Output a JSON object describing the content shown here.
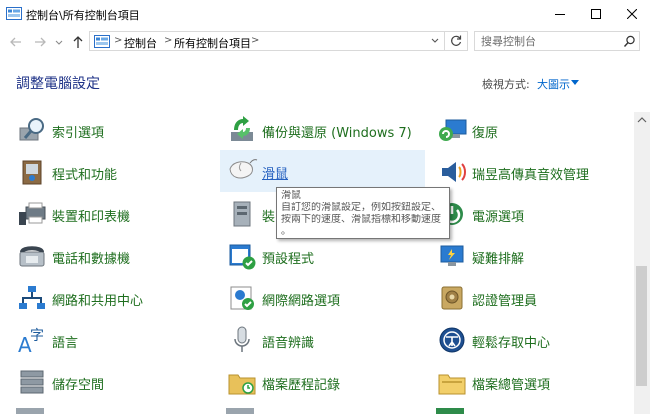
{
  "window": {
    "title": "控制台\\所有控制台項目",
    "icon": "control-panel-icon",
    "minimize_icon": "minimize-icon",
    "maximize_icon": "maximize-icon",
    "close_icon": "close-icon"
  },
  "address_bar": {
    "back_icon": "back-arrow-icon",
    "forward_icon": "forward-arrow-icon",
    "history_icon": "chevron-down-icon",
    "up_icon": "up-arrow-icon",
    "breadcrumbs": [
      "控制台",
      "所有控制台項目"
    ],
    "separator": ">",
    "dropdown_icon": "chevron-down-icon",
    "refresh_icon": "refresh-icon"
  },
  "search": {
    "placeholder": "搜尋控制台",
    "value": "",
    "icon": "search-icon"
  },
  "header": {
    "title": "調整電腦設定",
    "view_label": "檢視方式:",
    "view_value": "大圖示"
  },
  "items": [
    {
      "label": "索引選項",
      "icon": "indexing-options-icon"
    },
    {
      "label": "備份與還原 (Windows 7)",
      "icon": "backup-restore-icon"
    },
    {
      "label": "復原",
      "icon": "recovery-icon"
    },
    {
      "label": "程式和功能",
      "icon": "programs-features-icon"
    },
    {
      "label": "滑鼠",
      "icon": "mouse-icon"
    },
    {
      "label": "瑞昱高傳真音效管理",
      "icon": "realtek-audio-icon"
    },
    {
      "label": "裝置和印表機",
      "icon": "devices-printers-icon"
    },
    {
      "label": "裝",
      "icon": "device-manager-icon"
    },
    {
      "label": "電源選項",
      "icon": "power-options-icon"
    },
    {
      "label": "電話和數據機",
      "icon": "phone-modem-icon"
    },
    {
      "label": "預設程式",
      "icon": "default-programs-icon"
    },
    {
      "label": "疑難排解",
      "icon": "troubleshooting-icon"
    },
    {
      "label": "網路和共用中心",
      "icon": "network-sharing-icon"
    },
    {
      "label": "網際網路選項",
      "icon": "internet-options-icon"
    },
    {
      "label": "認證管理員",
      "icon": "credential-manager-icon"
    },
    {
      "label": "語言",
      "icon": "language-icon"
    },
    {
      "label": "語音辨識",
      "icon": "speech-recognition-icon"
    },
    {
      "label": "輕鬆存取中心",
      "icon": "ease-of-access-icon"
    },
    {
      "label": "儲存空間",
      "icon": "storage-spaces-icon"
    },
    {
      "label": "檔案歷程記錄",
      "icon": "file-history-icon"
    },
    {
      "label": "檔案總管選項",
      "icon": "file-explorer-options-icon"
    }
  ],
  "tooltip": {
    "title": "滑鼠",
    "lines": [
      "自訂您的滑鼠設定，例如按鈕設定、",
      "按兩下的速度、滑鼠指標和移動速度",
      "。"
    ]
  },
  "colors": {
    "link_green": "#1e6e1e",
    "header_blue": "#1e3287",
    "hover_bg": "#e5f1fb"
  }
}
